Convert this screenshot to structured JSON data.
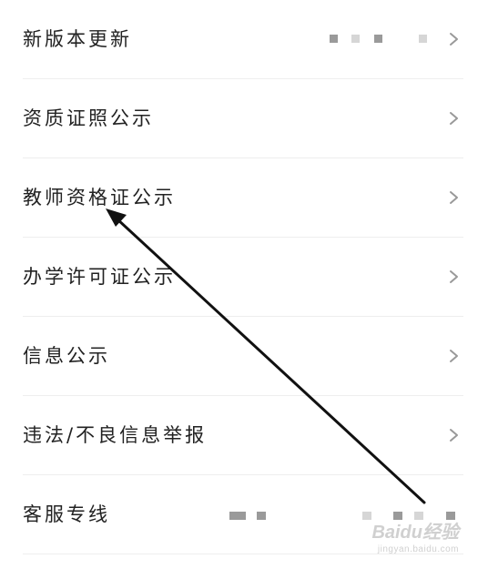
{
  "settings": {
    "items": [
      {
        "label": "新版本更新",
        "has_chevron": true
      },
      {
        "label": "资质证照公示",
        "has_chevron": true
      },
      {
        "label": "教师资格证公示",
        "has_chevron": true
      },
      {
        "label": "办学许可证公示",
        "has_chevron": true
      },
      {
        "label": "信息公示",
        "has_chevron": true
      },
      {
        "label": "违法/不良信息举报",
        "has_chevron": true
      },
      {
        "label": "客服专线",
        "has_chevron": false
      }
    ]
  },
  "icons": {
    "chevron": "chevron-right-icon"
  },
  "colors": {
    "text": "#222222",
    "chevron": "#999999",
    "divider": "#eeeeee",
    "arrow": "#111111"
  },
  "watermark": {
    "brand": "Baidu经验",
    "sub": "jingyan.baidu.com"
  }
}
